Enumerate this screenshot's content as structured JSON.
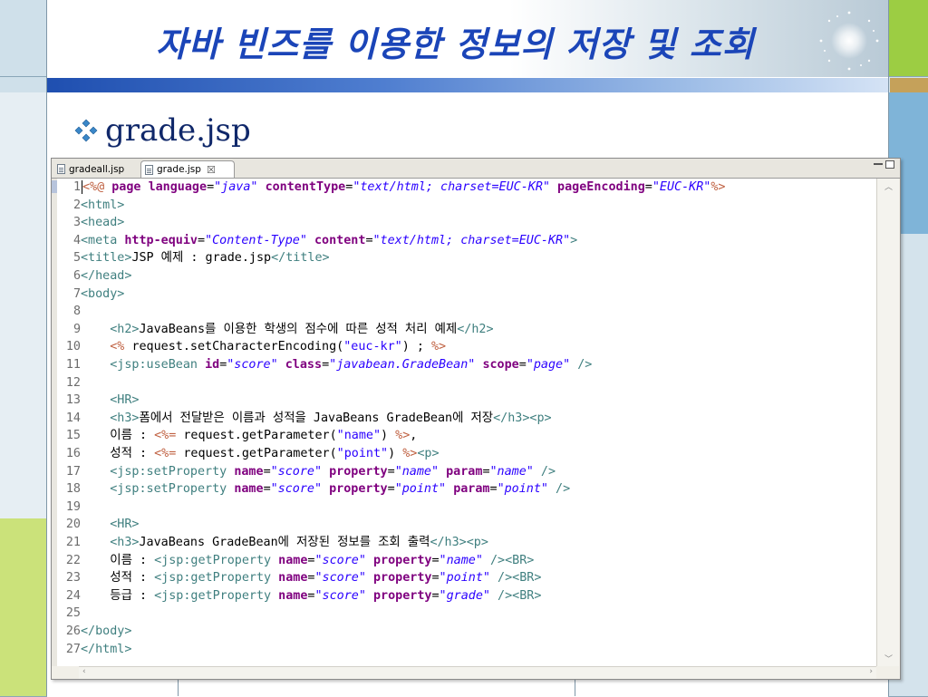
{
  "slide": {
    "title": "자바 빈즈를 이용한 정보의 저장 및 조회",
    "bullet": "grade.jsp",
    "bullet_icon": "diamond-bullet-icon"
  },
  "editor": {
    "tabs": [
      {
        "label": "gradeall.jsp",
        "active": false
      },
      {
        "label": "grade.jsp",
        "active": true
      }
    ],
    "close_glyph": "☒",
    "lines": [
      [
        [
          "jsp",
          "<%@ "
        ],
        [
          "attr",
          "page "
        ],
        [
          "attr",
          "language"
        ],
        [
          "code",
          "="
        ],
        [
          "val",
          "\"java\""
        ],
        [
          "code",
          " "
        ],
        [
          "attr",
          "contentType"
        ],
        [
          "code",
          "="
        ],
        [
          "val",
          "\"text/html; charset=EUC-KR\""
        ],
        [
          "code",
          " "
        ],
        [
          "attr",
          "pageEncoding"
        ],
        [
          "code",
          "="
        ],
        [
          "val",
          "\"EUC-KR\""
        ],
        [
          "jsp",
          "%>"
        ]
      ],
      [
        [
          "tag",
          "<html>"
        ]
      ],
      [
        [
          "tag",
          "<head>"
        ]
      ],
      [
        [
          "tag",
          "<meta "
        ],
        [
          "attr",
          "http-equiv"
        ],
        [
          "code",
          "="
        ],
        [
          "val",
          "\"Content-Type\""
        ],
        [
          "code",
          " "
        ],
        [
          "attr",
          "content"
        ],
        [
          "code",
          "="
        ],
        [
          "val",
          "\"text/html; charset=EUC-KR\""
        ],
        [
          "tag",
          ">"
        ]
      ],
      [
        [
          "tag",
          "<title>"
        ],
        [
          "code",
          "JSP 예제 : grade.jsp"
        ],
        [
          "tag",
          "</title>"
        ]
      ],
      [
        [
          "tag",
          "</head>"
        ]
      ],
      [
        [
          "tag",
          "<body>"
        ]
      ],
      [],
      [
        [
          "code",
          "    "
        ],
        [
          "tag",
          "<h2>"
        ],
        [
          "code",
          "JavaBeans를 이용한 학생의 점수에 따른 성적 처리 예제"
        ],
        [
          "tag",
          "</h2>"
        ]
      ],
      [
        [
          "code",
          "    "
        ],
        [
          "jsp",
          "<% "
        ],
        [
          "code",
          "request.setCharacterEncoding("
        ],
        [
          "str",
          "\"euc-kr\""
        ],
        [
          "code",
          ") ; "
        ],
        [
          "jsp",
          "%>"
        ]
      ],
      [
        [
          "code",
          "    "
        ],
        [
          "tag",
          "<jsp:useBean "
        ],
        [
          "attr",
          "id"
        ],
        [
          "code",
          "="
        ],
        [
          "val",
          "\"score\""
        ],
        [
          "code",
          " "
        ],
        [
          "attr",
          "class"
        ],
        [
          "code",
          "="
        ],
        [
          "val",
          "\"javabean.GradeBean\""
        ],
        [
          "code",
          " "
        ],
        [
          "attr",
          "scope"
        ],
        [
          "code",
          "="
        ],
        [
          "val",
          "\"page\""
        ],
        [
          "tag",
          " />"
        ]
      ],
      [],
      [
        [
          "code",
          "    "
        ],
        [
          "tag",
          "<HR>"
        ]
      ],
      [
        [
          "code",
          "    "
        ],
        [
          "tag",
          "<h3>"
        ],
        [
          "code",
          "폼에서 전달받은 이름과 성적을 JavaBeans GradeBean에 저장"
        ],
        [
          "tag",
          "</h3><p>"
        ]
      ],
      [
        [
          "code",
          "    이름 : "
        ],
        [
          "jsp",
          "<%= "
        ],
        [
          "code",
          "request.getParameter("
        ],
        [
          "str",
          "\"name\""
        ],
        [
          "code",
          ") "
        ],
        [
          "jsp",
          "%>"
        ],
        [
          "code",
          ","
        ]
      ],
      [
        [
          "code",
          "    성적 : "
        ],
        [
          "jsp",
          "<%= "
        ],
        [
          "code",
          "request.getParameter("
        ],
        [
          "str",
          "\"point\""
        ],
        [
          "code",
          ") "
        ],
        [
          "jsp",
          "%>"
        ],
        [
          "tag",
          "<p>"
        ]
      ],
      [
        [
          "code",
          "    "
        ],
        [
          "tag",
          "<jsp:setProperty "
        ],
        [
          "attr",
          "name"
        ],
        [
          "code",
          "="
        ],
        [
          "val",
          "\"score\""
        ],
        [
          "code",
          " "
        ],
        [
          "attr",
          "property"
        ],
        [
          "code",
          "="
        ],
        [
          "val",
          "\"name\""
        ],
        [
          "code",
          " "
        ],
        [
          "attr",
          "param"
        ],
        [
          "code",
          "="
        ],
        [
          "val",
          "\"name\""
        ],
        [
          "tag",
          " />"
        ]
      ],
      [
        [
          "code",
          "    "
        ],
        [
          "tag",
          "<jsp:setProperty "
        ],
        [
          "attr",
          "name"
        ],
        [
          "code",
          "="
        ],
        [
          "val",
          "\"score\""
        ],
        [
          "code",
          " "
        ],
        [
          "attr",
          "property"
        ],
        [
          "code",
          "="
        ],
        [
          "val",
          "\"point\""
        ],
        [
          "code",
          " "
        ],
        [
          "attr",
          "param"
        ],
        [
          "code",
          "="
        ],
        [
          "val",
          "\"point\""
        ],
        [
          "tag",
          " />"
        ]
      ],
      [],
      [
        [
          "code",
          "    "
        ],
        [
          "tag",
          "<HR>"
        ]
      ],
      [
        [
          "code",
          "    "
        ],
        [
          "tag",
          "<h3>"
        ],
        [
          "code",
          "JavaBeans GradeBean에 저장된 정보를 조회 출력"
        ],
        [
          "tag",
          "</h3><p>"
        ]
      ],
      [
        [
          "code",
          "    이름 : "
        ],
        [
          "tag",
          "<jsp:getProperty "
        ],
        [
          "attr",
          "name"
        ],
        [
          "code",
          "="
        ],
        [
          "val",
          "\"score\""
        ],
        [
          "code",
          " "
        ],
        [
          "attr",
          "property"
        ],
        [
          "code",
          "="
        ],
        [
          "val",
          "\"name\""
        ],
        [
          "tag",
          " /><BR>"
        ]
      ],
      [
        [
          "code",
          "    성적 : "
        ],
        [
          "tag",
          "<jsp:getProperty "
        ],
        [
          "attr",
          "name"
        ],
        [
          "code",
          "="
        ],
        [
          "val",
          "\"score\""
        ],
        [
          "code",
          " "
        ],
        [
          "attr",
          "property"
        ],
        [
          "code",
          "="
        ],
        [
          "val",
          "\"point\""
        ],
        [
          "tag",
          " /><BR>"
        ]
      ],
      [
        [
          "code",
          "    등급 : "
        ],
        [
          "tag",
          "<jsp:getProperty "
        ],
        [
          "attr",
          "name"
        ],
        [
          "code",
          "="
        ],
        [
          "val",
          "\"score\""
        ],
        [
          "code",
          " "
        ],
        [
          "attr",
          "property"
        ],
        [
          "code",
          "="
        ],
        [
          "val",
          "\"grade\""
        ],
        [
          "tag",
          " /><BR>"
        ]
      ],
      [],
      [
        [
          "tag",
          "</body>"
        ]
      ],
      [
        [
          "tag",
          "</html>"
        ]
      ]
    ]
  },
  "colors": {
    "title": "#1b45b8",
    "bullet_text": "#10286a",
    "jsp_tag": "#3f7f7f",
    "attribute": "#7f007f",
    "attribute_value": "#2a00ff",
    "scriptlet": "#bf5f3f"
  }
}
